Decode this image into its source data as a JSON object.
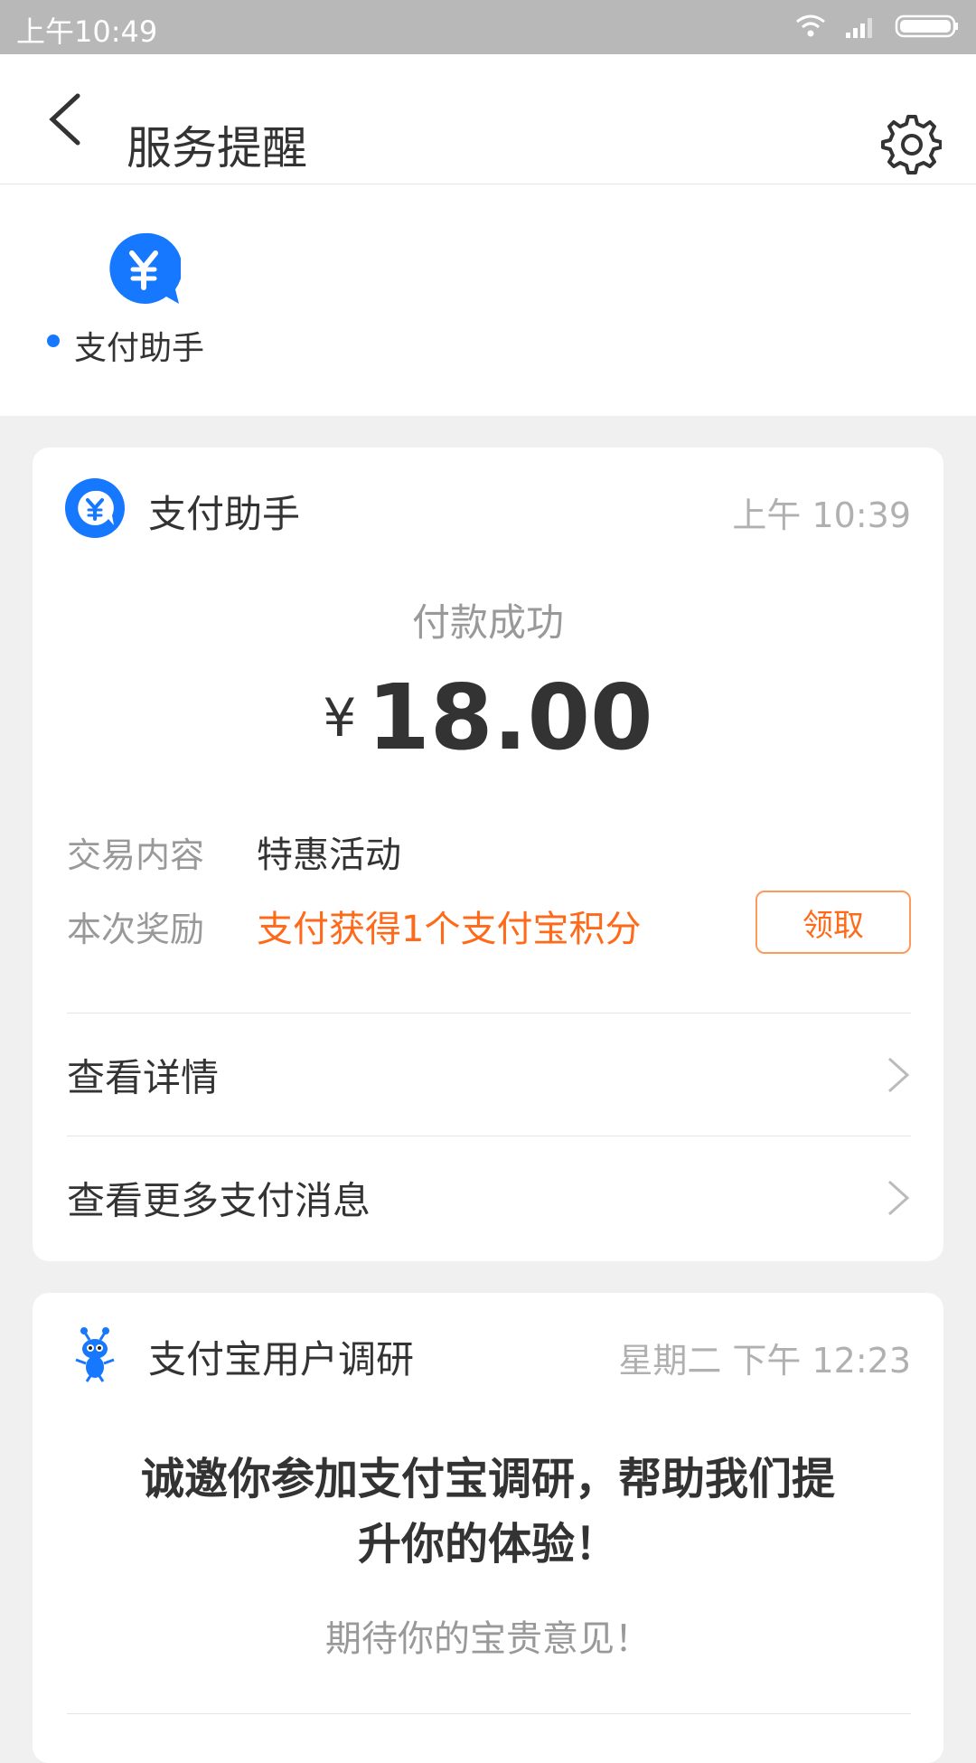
{
  "status_bar": {
    "time": "上午10:49"
  },
  "header": {
    "title": "服务提醒"
  },
  "strip": {
    "label": "支付助手"
  },
  "payment_card": {
    "title": "支付助手",
    "time": "上午 10:39",
    "status": "付款成功",
    "currency": "¥",
    "amount": "18.00",
    "rows": [
      {
        "label": "交易内容",
        "value": "特惠活动"
      },
      {
        "label": "本次奖励",
        "value": "支付获得1个支付宝积分"
      }
    ],
    "claim_label": "领取",
    "links": [
      {
        "label": "查看详情"
      },
      {
        "label": "查看更多支付消息"
      }
    ]
  },
  "survey_card": {
    "title": "支付宝用户调研",
    "time": "星期二 下午 12:23",
    "headline": "诚邀你参加支付宝调研，帮助我们提升你的体验！",
    "subtitle": "期待你的宝贵意见！"
  },
  "colors": {
    "accent_blue": "#1677ff",
    "orange": "#ff6a1a"
  },
  "icons": [
    "back-arrow-icon",
    "gear-icon",
    "yen-chat-icon",
    "ant-mascot-icon",
    "chevron-right-icon",
    "wifi-icon",
    "signal-icon",
    "battery-icon"
  ]
}
